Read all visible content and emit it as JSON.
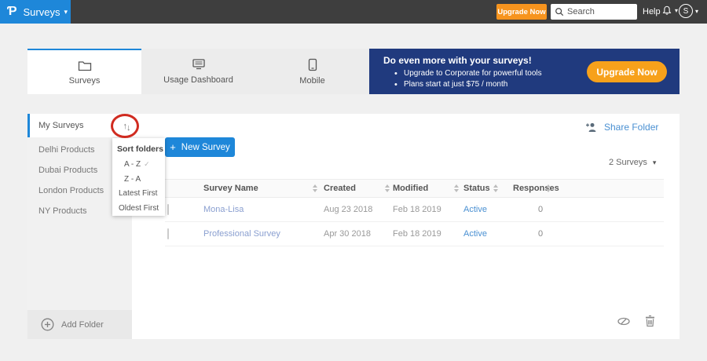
{
  "topbar": {
    "app_menu": "Surveys",
    "upgrade_label": "Upgrade Now",
    "search_placeholder": "Search",
    "help_label": "Help",
    "avatar_initial": "S"
  },
  "icons": {
    "logo": "Ƥ",
    "caret_down": "▾",
    "sort_glyph_up": "↑",
    "sort_glyph_down": "↓",
    "check": "✓",
    "plus": "+"
  },
  "tabs": [
    {
      "label": "Surveys",
      "icon": "folder-icon",
      "active": true
    },
    {
      "label": "Usage Dashboard",
      "icon": "dashboard-icon",
      "active": false
    },
    {
      "label": "Mobile",
      "icon": "mobile-icon",
      "active": false
    }
  ],
  "banner": {
    "title": "Do even more with your surveys!",
    "bullets": [
      "Upgrade to Corporate for powerful tools",
      "Plans start at just $75 / month"
    ],
    "button_label": "Upgrade Now"
  },
  "sidebar": {
    "items": [
      {
        "label": "My Surveys",
        "active": true
      },
      {
        "label": "Delhi Products",
        "active": false
      },
      {
        "label": "Dubai Products",
        "active": false
      },
      {
        "label": "London Products",
        "active": false
      },
      {
        "label": "NY Products",
        "active": false
      }
    ],
    "add_folder_label": "Add Folder"
  },
  "sort_menu": {
    "title": "Sort folders",
    "options": [
      {
        "label": "A - Z",
        "selected": true
      },
      {
        "label": "Z - A",
        "selected": false
      },
      {
        "label": "Latest First",
        "selected": false
      },
      {
        "label": "Oldest First",
        "selected": false
      }
    ]
  },
  "toolbar": {
    "share_folder_label": "Share Folder",
    "new_survey_label": "New Survey",
    "count_label": "2 Surveys"
  },
  "table": {
    "headers": [
      "Survey Name",
      "Created",
      "Modified",
      "Status",
      "Responses"
    ],
    "rows": [
      {
        "name": "Mona-Lisa",
        "created": "Aug 23 2018",
        "modified": "Feb 18 2019",
        "status": "Active",
        "responses": "0"
      },
      {
        "name": "Professional Survey",
        "created": "Apr 30 2018",
        "modified": "Feb 18 2019",
        "status": "Active",
        "responses": "0"
      }
    ]
  },
  "colors": {
    "accent_blue": "#1e87d9",
    "topbar_bg": "#3e3e3e",
    "orange": "#f7941e",
    "banner_navy": "#203a7e",
    "banner_orange": "#f7a11b",
    "link_blue": "#8a9fd0",
    "status_active": "#4a90d2",
    "annotation_red": "#d02b20"
  }
}
